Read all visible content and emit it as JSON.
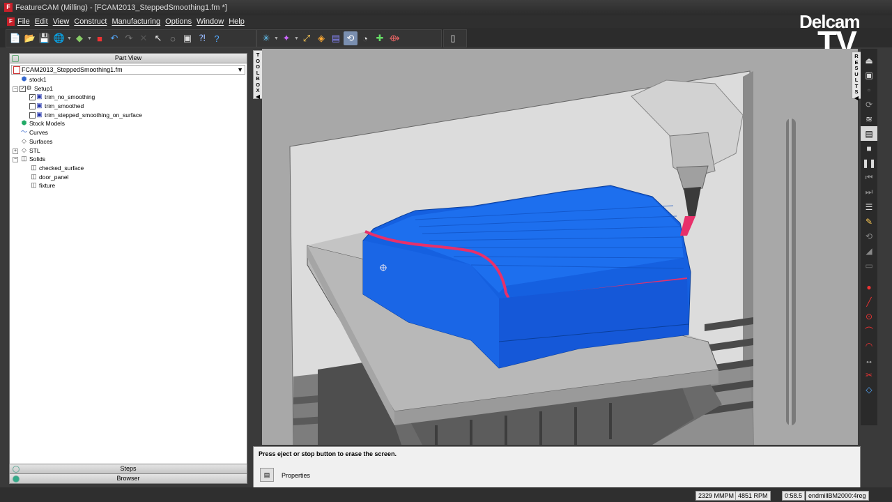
{
  "window": {
    "title": "FeatureCAM (Milling) - [FCAM2013_SteppedSmoothing1.fm *]"
  },
  "menu": [
    "File",
    "Edit",
    "View",
    "Construct",
    "Manufacturing",
    "Options",
    "Window",
    "Help"
  ],
  "branding": {
    "line1": "Delcam",
    "line2": "TV"
  },
  "toolbar_groups": [
    {
      "icons": [
        "new-icon",
        "open-icon",
        "save-icon",
        "globe-icon",
        "part-view-icon",
        "solid-icon",
        "undo-icon",
        "redo-icon",
        "delete-icon",
        "select-arrow-icon",
        "lasso-icon",
        "camera-icon",
        "help-cursor-icon",
        "help-icon"
      ]
    },
    {
      "icons": [
        "star-icon",
        "magic-icon",
        "curve-icon",
        "feature-icon",
        "toolbox-icon",
        "wizard-icon",
        "simulate-icon",
        "transform-icon",
        "align-icon"
      ]
    },
    {
      "icons": [
        "nc-code-icon"
      ]
    }
  ],
  "part_view": {
    "header": "Part View",
    "file": "FCAM2013_SteppedSmoothing1.fm",
    "tree": [
      {
        "label": "stock1",
        "indent": 1,
        "icon": "stock-icon"
      },
      {
        "label": "Setup1",
        "indent": 1,
        "icon": "setup-icon",
        "expanded": true,
        "checked": true
      },
      {
        "label": "trim_no_smoothing",
        "indent": 2,
        "icon": "feature-icon",
        "checked": true
      },
      {
        "label": "trim_smoothed",
        "indent": 2,
        "icon": "feature-icon",
        "checked": false
      },
      {
        "label": "trim_stepped_smoothing_on_surface",
        "indent": 2,
        "icon": "feature-icon",
        "checked": false
      },
      {
        "label": "Stock Models",
        "indent": 1,
        "icon": "stock-models-icon"
      },
      {
        "label": "Curves",
        "indent": 1,
        "icon": "curve-icon"
      },
      {
        "label": "Surfaces",
        "indent": 1,
        "icon": "surface-icon"
      },
      {
        "label": "STL",
        "indent": 1,
        "icon": "stl-icon",
        "collapsed": true
      },
      {
        "label": "Solids",
        "indent": 1,
        "icon": "solid-icon",
        "expanded": true
      },
      {
        "label": "checked_surface",
        "indent": 2,
        "icon": "solid-icon"
      },
      {
        "label": "door_panel",
        "indent": 2,
        "icon": "solid-icon"
      },
      {
        "label": "fixture",
        "indent": 2,
        "icon": "solid-icon"
      }
    ]
  },
  "bottom_tabs": {
    "steps": "Steps",
    "browser": "Browser"
  },
  "toolbox_tab": "TOOLBOX",
  "results_tab": "RESULTS",
  "message": "Press eject or stop button to erase the screen.",
  "properties_label": "Properties",
  "status": {
    "mmpm": "2329 MMPM",
    "rpm": "4851 RPM",
    "time": "0:58.5",
    "tool": "endmillBM2000:4reg"
  },
  "right_toolbar": [
    "eject-icon",
    "fit-icon",
    "blank-icon",
    "rotate-icon",
    "toolpath-icon",
    "stock-view-icon",
    "stop-icon",
    "pause-icon",
    "rewind-icon",
    "step-forward-icon",
    "list-icon",
    "pencil-icon",
    "spin-icon",
    "shade-icon",
    "blank2-icon",
    "point-icon",
    "line-icon",
    "circle-icon",
    "arc-icon",
    "arc2-icon",
    "dimension-icon",
    "trim-icon",
    "edit-icon"
  ],
  "colors": {
    "part": "#1565e0",
    "highlight": "#e8306a",
    "background": "#a9a9a9"
  }
}
